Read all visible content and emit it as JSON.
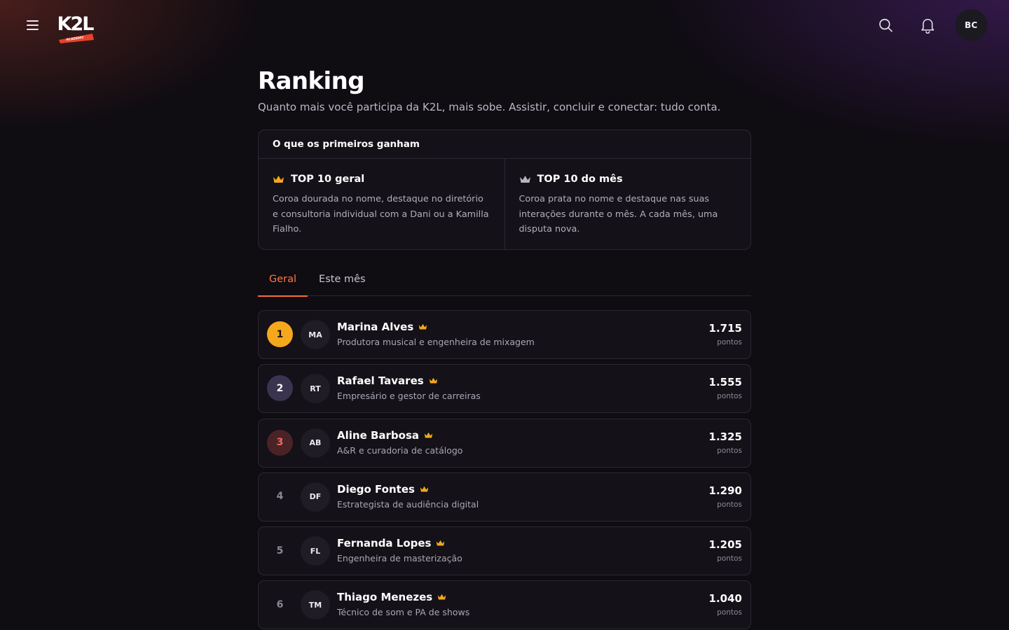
{
  "header": {
    "logo_text": "K2L",
    "logo_sub": "ACADEMY",
    "avatar_initials": "BC"
  },
  "page": {
    "title": "Ranking",
    "subtitle": "Quanto mais você participa da K2L, mais sobe. Assistir, concluir e conectar: tudo conta."
  },
  "rewards": {
    "heading": "O que os primeiros ganham",
    "items": [
      {
        "title": "TOP 10 geral",
        "description": "Coroa dourada no nome, destaque no diretório e consultoria individual com a Dani ou a Kamilla Fialho.",
        "crown_color": "#f5a81c"
      },
      {
        "title": "TOP 10 do mês",
        "description": "Coroa prata no nome e destaque nas suas interações durante o mês. A cada mês, uma disputa nova.",
        "crown_color": "#b8b4c0"
      }
    ]
  },
  "tabs": [
    {
      "label": "Geral",
      "active": true
    },
    {
      "label": "Este mês",
      "active": false
    }
  ],
  "ranking": {
    "points_label": "pontos",
    "rows": [
      {
        "rank": "1",
        "initials": "MA",
        "name": "Marina Alves",
        "role": "Produtora musical e engenheira de mixagem",
        "points": "1.715",
        "style": "gold"
      },
      {
        "rank": "2",
        "initials": "RT",
        "name": "Rafael Tavares",
        "role": "Empresário e gestor de carreiras",
        "points": "1.555",
        "style": "silver"
      },
      {
        "rank": "3",
        "initials": "AB",
        "name": "Aline Barbosa",
        "role": "A&R e curadoria de catálogo",
        "points": "1.325",
        "style": "bronze"
      },
      {
        "rank": "4",
        "initials": "DF",
        "name": "Diego Fontes",
        "role": "Estrategista de audiência digital",
        "points": "1.290",
        "style": "plain"
      },
      {
        "rank": "5",
        "initials": "FL",
        "name": "Fernanda Lopes",
        "role": "Engenheira de masterização",
        "points": "1.205",
        "style": "plain"
      },
      {
        "rank": "6",
        "initials": "TM",
        "name": "Thiago Menezes",
        "role": "Técnico de som e PA de shows",
        "points": "1.040",
        "style": "plain"
      }
    ]
  },
  "colors": {
    "accent": "#ff6b35",
    "gold": "#f5a81c",
    "background": "#0f0c12"
  }
}
